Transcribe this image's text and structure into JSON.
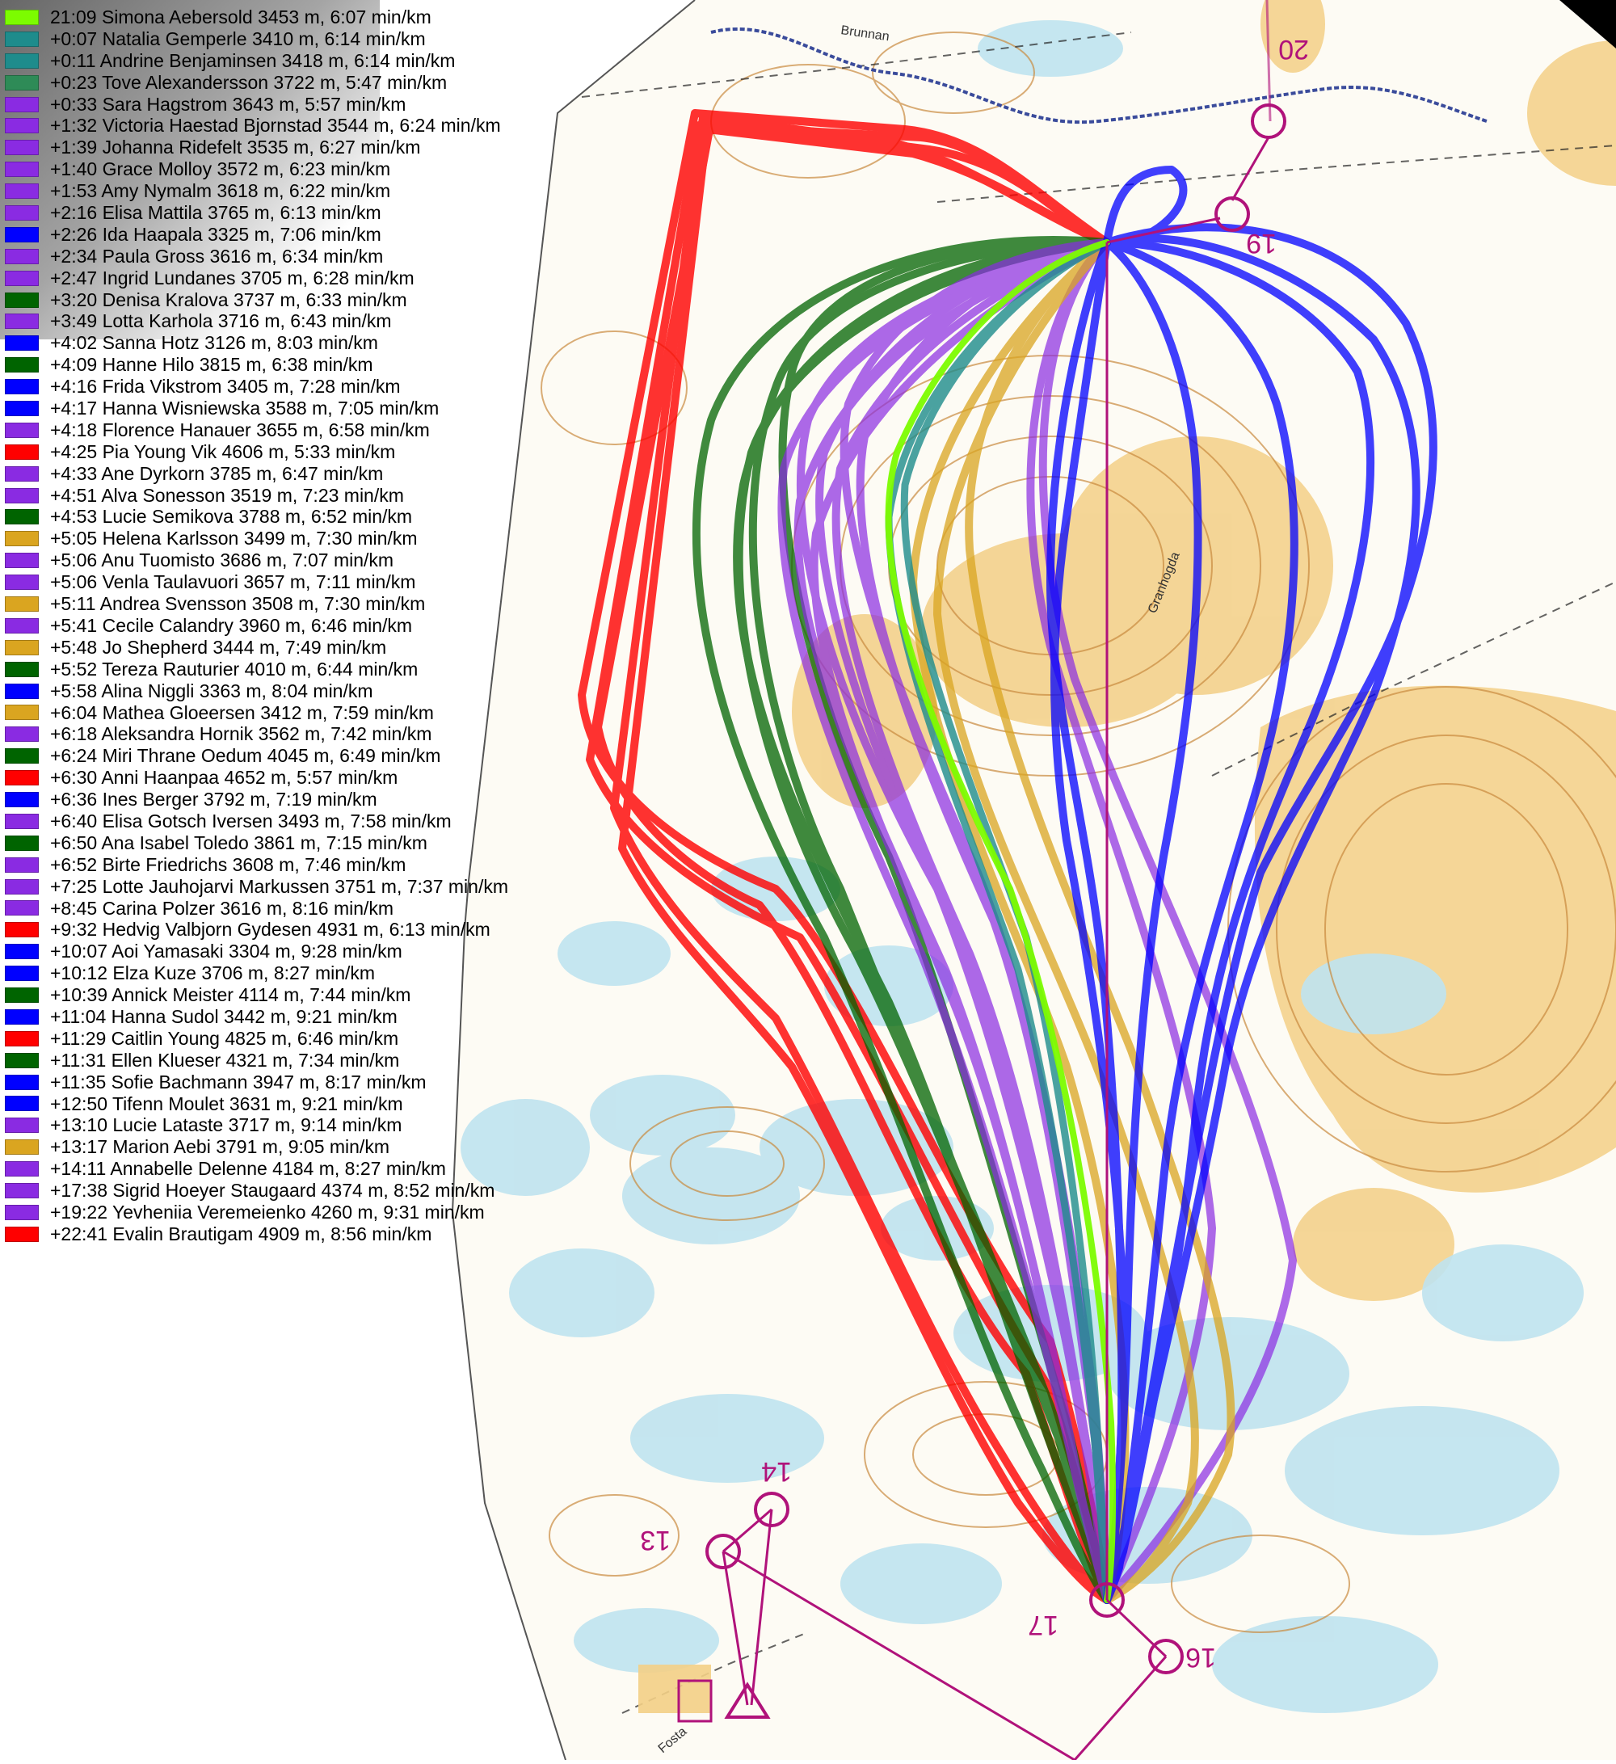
{
  "legend": [
    {
      "text": "21:09 Simona Aebersold 3453 m, 6:07 min/km",
      "color": "#7cfc00"
    },
    {
      "text": "+0:07 Natalia Gemperle 3410 m, 6:14 min/km",
      "color": "#1e8c8c"
    },
    {
      "text": "+0:11 Andrine Benjaminsen 3418 m, 6:14 min/km",
      "color": "#1e8c8c"
    },
    {
      "text": "+0:23 Tove Alexandersson 3722 m, 5:47 min/km",
      "color": "#2e8b57"
    },
    {
      "text": "+0:33 Sara Hagstrom 3643 m, 5:57 min/km",
      "color": "#8a2be2"
    },
    {
      "text": "+1:32 Victoria Haestad Bjornstad 3544 m, 6:24 min/km",
      "color": "#8a2be2"
    },
    {
      "text": "+1:39 Johanna Ridefelt 3535 m, 6:27 min/km",
      "color": "#8a2be2"
    },
    {
      "text": "+1:40 Grace Molloy 3572 m, 6:23 min/km",
      "color": "#8a2be2"
    },
    {
      "text": "+1:53 Amy Nymalm 3618 m, 6:22 min/km",
      "color": "#8a2be2"
    },
    {
      "text": "+2:16 Elisa Mattila 3765 m, 6:13 min/km",
      "color": "#8a2be2"
    },
    {
      "text": "+2:26 Ida Haapala 3325 m, 7:06 min/km",
      "color": "#0000ff"
    },
    {
      "text": "+2:34 Paula Gross 3616 m, 6:34 min/km",
      "color": "#8a2be2"
    },
    {
      "text": "+2:47 Ingrid Lundanes 3705 m, 6:28 min/km",
      "color": "#8a2be2"
    },
    {
      "text": "+3:20 Denisa Kralova 3737 m, 6:33 min/km",
      "color": "#006400"
    },
    {
      "text": "+3:49 Lotta Karhola 3716 m, 6:43 min/km",
      "color": "#8a2be2"
    },
    {
      "text": "+4:02 Sanna Hotz 3126 m, 8:03 min/km",
      "color": "#0000ff"
    },
    {
      "text": "+4:09 Hanne Hilo 3815 m, 6:38 min/km",
      "color": "#006400"
    },
    {
      "text": "+4:16 Frida Vikstrom 3405 m, 7:28 min/km",
      "color": "#0000ff"
    },
    {
      "text": "+4:17 Hanna Wisniewska 3588 m, 7:05 min/km",
      "color": "#0000ff"
    },
    {
      "text": "+4:18 Florence Hanauer 3655 m, 6:58 min/km",
      "color": "#8a2be2"
    },
    {
      "text": "+4:25 Pia Young Vik 4606 m, 5:33 min/km",
      "color": "#ff0000"
    },
    {
      "text": "+4:33 Ane Dyrkorn 3785 m, 6:47 min/km",
      "color": "#8a2be2"
    },
    {
      "text": "+4:51 Alva Sonesson 3519 m, 7:23 min/km",
      "color": "#8a2be2"
    },
    {
      "text": "+4:53 Lucie Semikova 3788 m, 6:52 min/km",
      "color": "#006400"
    },
    {
      "text": "+5:05 Helena Karlsson 3499 m, 7:30 min/km",
      "color": "#daa520"
    },
    {
      "text": "+5:06 Anu Tuomisto 3686 m, 7:07 min/km",
      "color": "#8a2be2"
    },
    {
      "text": "+5:06 Venla Taulavuori 3657 m, 7:11 min/km",
      "color": "#8a2be2"
    },
    {
      "text": "+5:11 Andrea Svensson 3508 m, 7:30 min/km",
      "color": "#daa520"
    },
    {
      "text": "+5:41 Cecile Calandry 3960 m, 6:46 min/km",
      "color": "#8a2be2"
    },
    {
      "text": "+5:48 Jo Shepherd 3444 m, 7:49 min/km",
      "color": "#daa520"
    },
    {
      "text": "+5:52 Tereza Rauturier 4010 m, 6:44 min/km",
      "color": "#006400"
    },
    {
      "text": "+5:58 Alina Niggli 3363 m, 8:04 min/km",
      "color": "#0000ff"
    },
    {
      "text": "+6:04 Mathea Gloeersen 3412 m, 7:59 min/km",
      "color": "#daa520"
    },
    {
      "text": "+6:18 Aleksandra Hornik 3562 m, 7:42 min/km",
      "color": "#8a2be2"
    },
    {
      "text": "+6:24 Miri Thrane Oedum 4045 m, 6:49 min/km",
      "color": "#006400"
    },
    {
      "text": "+6:30 Anni Haanpaa 4652 m, 5:57 min/km",
      "color": "#ff0000"
    },
    {
      "text": "+6:36 Ines Berger 3792 m, 7:19 min/km",
      "color": "#0000ff"
    },
    {
      "text": "+6:40 Elisa Gotsch Iversen 3493 m, 7:58 min/km",
      "color": "#8a2be2"
    },
    {
      "text": "+6:50 Ana Isabel Toledo 3861 m, 7:15 min/km",
      "color": "#006400"
    },
    {
      "text": "+6:52 Birte Friedrichs 3608 m, 7:46 min/km",
      "color": "#8a2be2"
    },
    {
      "text": "+7:25 Lotte Jauhojarvi Markussen 3751 m, 7:37 min/km",
      "color": "#8a2be2"
    },
    {
      "text": "+8:45 Carina Polzer 3616 m, 8:16 min/km",
      "color": "#8a2be2"
    },
    {
      "text": "+9:32 Hedvig Valbjorn Gydesen 4931 m, 6:13 min/km",
      "color": "#ff0000"
    },
    {
      "text": "+10:07 Aoi Yamasaki 3304 m, 9:28 min/km",
      "color": "#0000ff"
    },
    {
      "text": "+10:12 Elza Kuze 3706 m, 8:27 min/km",
      "color": "#0000ff"
    },
    {
      "text": "+10:39 Annick Meister 4114 m, 7:44 min/km",
      "color": "#006400"
    },
    {
      "text": "+11:04 Hanna Sudol 3442 m, 9:21 min/km",
      "color": "#0000ff"
    },
    {
      "text": "+11:29 Caitlin Young 4825 m, 6:46 min/km",
      "color": "#ff0000"
    },
    {
      "text": "+11:31 Ellen Klueser 4321 m, 7:34 min/km",
      "color": "#006400"
    },
    {
      "text": "+11:35 Sofie Bachmann 3947 m, 8:17 min/km",
      "color": "#0000ff"
    },
    {
      "text": "+12:50 Tifenn Moulet 3631 m, 9:21 min/km",
      "color": "#0000ff"
    },
    {
      "text": "+13:10 Lucie Lataste 3717 m, 9:14 min/km",
      "color": "#8a2be2"
    },
    {
      "text": "+13:17 Marion Aebi 3791 m, 9:05 min/km",
      "color": "#daa520"
    },
    {
      "text": "+14:11 Annabelle Delenne 4184 m, 8:27 min/km",
      "color": "#8a2be2"
    },
    {
      "text": "+17:38 Sigrid Hoeyer Staugaard 4374 m, 8:52 min/km",
      "color": "#8a2be2"
    },
    {
      "text": "+19:22 Yevheniia Veremeienko 4260 m, 9:31 min/km",
      "color": "#8a2be2"
    },
    {
      "text": "+22:41 Evalin Brautigam 4909 m, 8:56 min/km",
      "color": "#ff0000"
    }
  ],
  "controls": [
    {
      "label": "13",
      "icon": "control-circle-icon"
    },
    {
      "label": "14",
      "icon": "control-circle-icon"
    },
    {
      "label": "16",
      "icon": "control-circle-icon"
    },
    {
      "label": "17",
      "icon": "control-circle-icon"
    },
    {
      "label": "19",
      "icon": "control-circle-icon"
    },
    {
      "label": "20",
      "icon": "control-circle-icon"
    }
  ],
  "map_labels": [
    "Brunnan",
    "Granhogda",
    "Fosta"
  ],
  "colors": {
    "map_background": "#fdfbf4",
    "open_land": "#f3cf86",
    "marsh_water": "#bfe3ef",
    "contour": "#c98a3e",
    "course_overprint": "#b0127a",
    "start_triangle": "#b0127a"
  }
}
